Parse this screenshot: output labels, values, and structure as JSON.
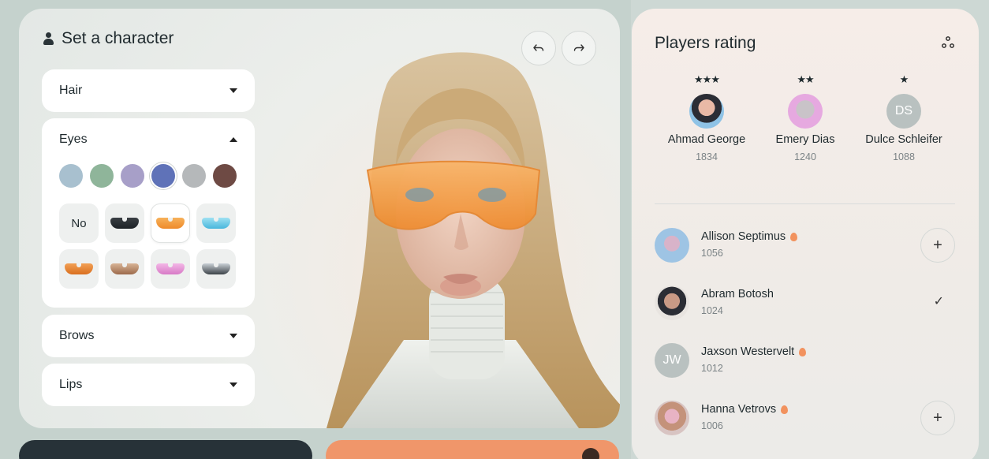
{
  "character": {
    "title": "Set a character",
    "icons": {
      "title": "person-icon",
      "undo": "undo-icon",
      "redo": "redo-icon"
    },
    "sections": [
      {
        "label": "Hair",
        "expanded": false
      },
      {
        "label": "Eyes",
        "expanded": true
      },
      {
        "label": "Brows",
        "expanded": false
      },
      {
        "label": "Lips",
        "expanded": false
      }
    ],
    "eye_colors": [
      "#a8c0cf",
      "#8fb59a",
      "#a79fc8",
      "#5f72b8",
      "#b5b8ba",
      "#6e4a44"
    ],
    "glasses": {
      "no_label": "No",
      "options": [
        "dark-goggles",
        "orange-goggles",
        "blue-goggles",
        "orange-shades",
        "brown-goggles",
        "pink-goggles",
        "silver-goggles"
      ],
      "selected": "orange-goggles"
    }
  },
  "rating": {
    "title": "Players rating",
    "share_icon": "share-icon",
    "podium": [
      {
        "stars": "★★★",
        "name": "Ahmad George",
        "score": "1834",
        "avatar": "avatar-photo"
      },
      {
        "stars": "★★",
        "name": "Emery Dias",
        "score": "1240",
        "avatar": "avatar-photo"
      },
      {
        "stars": "★",
        "name": "Dulce Schleifer",
        "score": "1088",
        "avatar": "DS"
      }
    ],
    "players": [
      {
        "name": "Allison Septimus",
        "score": "1056",
        "flame": true,
        "action": "+"
      },
      {
        "name": "Abram Botosh",
        "score": "1024",
        "flame": false,
        "action": "✓"
      },
      {
        "name": "Jaxson Westervelt",
        "score": "1012",
        "flame": true,
        "avatar": "JW",
        "action": ""
      },
      {
        "name": "Hanna Vetrovs",
        "score": "1006",
        "flame": true,
        "action": "+"
      }
    ]
  }
}
